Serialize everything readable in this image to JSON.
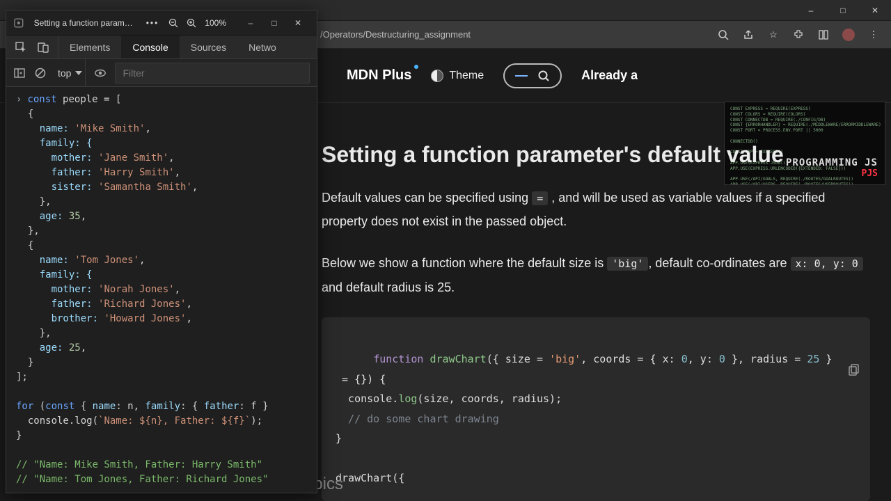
{
  "browser": {
    "url_path": "/Operators/Destructuring_assignment"
  },
  "mdn": {
    "plus": "MDN Plus",
    "theme": "Theme",
    "already": "Already a",
    "heading": "Setting a function parameter's default value",
    "para1_a": "Default values can be specified using ",
    "para1_code": "=",
    "para1_b": " , and will be used as variable values if a specified property does not exist in the passed object.",
    "para2_a": "Below we show a function where the default size is ",
    "para2_code1": "'big'",
    "para2_b": ", default co-ordinates are ",
    "para2_code2": "x: 0, y: 0",
    "para2_c": " and default radius is 25.",
    "code_block": "function drawChart({ size = 'big', coords = { x: 0, y: 0 }, radius = 25 }\n = {}) {\n  console.log(size, coords, radius);\n  // do some chart drawing\n}\n\ndrawChart({",
    "code_l1_kw": "function",
    "code_l1_fn": "drawChart",
    "code_l1_rest": "({ size = ",
    "code_l1_str": "'big'",
    "code_l1_mid": ", coords = { x: ",
    "code_l1_n1": "0",
    "code_l1_mid2": ", y: ",
    "code_l1_n2": "0",
    "code_l1_mid3": " }, radius = ",
    "code_l1_n3": "25",
    "code_l1_end": " }",
    "code_l2": " = {}) {",
    "code_l3a": "  console.",
    "code_l3b": "log",
    "code_l3c": "(size, coords, radius);",
    "code_l4": "  // do some chart drawing",
    "code_l5": "}",
    "code_l7": "drawChart({",
    "related": "Related Topics",
    "promo_brand": "PROGRAMMING JS",
    "promo_sub": "PJS",
    "promo_lines": "CONST EXPRESS = REQUIRE(EXPRESS)\nCONST COLORS = REQUIRE(COLORS)\nCONST CONNECTDB = REQUIRE(./CONFIG/DB)\nCONST {ERRORHANDLER} = REQUIRE(./MIDDLEWARE/ERRORMIDDLEWARE)\nCONST PORT = PROCESS.ENV.PORT || 5000\n\nCONNECTDB()\n\nCONST APP = EXPRESS()\n\nAPP.USE(EXPRESS.JSON())\nAPP.USE(EXPRESS.URLENCODED({EXTENDED: FALSE}))\n\nAPP.USE(/API/GOALS, REQUIRE(./ROUTES/GOALROUTES))\nAPP.USE(/API/USERS, REQUIRE(./ROUTES/USERROUTES))\n\nAPP.USE(ERRORHANDLER)\n\nAPP.LISTEN(PORT, () => CONSOLE.LOG(SERVER STARTED ON PORT ${PORT}))"
  },
  "devtools": {
    "title": "Setting a function paramet...",
    "zoom": "100%",
    "tabs": {
      "elements": "Elements",
      "console": "Console",
      "sources": "Sources",
      "network": "Netwo"
    },
    "context": "top",
    "filter_placeholder": "Filter",
    "console_lines": {
      "l01": "const people = [",
      "l02": "  {",
      "l03_a": "    name: ",
      "l03_s": "'Mike Smith'",
      "l03_b": ",",
      "l04": "    family: {",
      "l05_a": "      mother: ",
      "l05_s": "'Jane Smith'",
      "l05_b": ",",
      "l06_a": "      father: ",
      "l06_s": "'Harry Smith'",
      "l06_b": ",",
      "l07_a": "      sister: ",
      "l07_s": "'Samantha Smith'",
      "l07_b": ",",
      "l08": "    },",
      "l09_a": "    age: ",
      "l09_n": "35",
      "l09_b": ",",
      "l10": "  },",
      "l11": "  {",
      "l12_a": "    name: ",
      "l12_s": "'Tom Jones'",
      "l12_b": ",",
      "l13": "    family: {",
      "l14_a": "      mother: ",
      "l14_s": "'Norah Jones'",
      "l14_b": ",",
      "l15_a": "      father: ",
      "l15_s": "'Richard Jones'",
      "l15_b": ",",
      "l16_a": "      brother: ",
      "l16_s": "'Howard Jones'",
      "l16_b": ",",
      "l17": "    },",
      "l18_a": "    age: ",
      "l18_n": "25",
      "l18_b": ",",
      "l19": "  }",
      "l20": "];",
      "l22": "for (const { name: n, family: { father: f }",
      "l23": "  console.log(`Name: ${n}, Father: ${f}`);",
      "l24": "}",
      "l26": "// \"Name: Mike Smith, Father: Harry Smith\"",
      "l27": "// \"Name: Tom Jones, Father: Richard Jones\""
    }
  }
}
